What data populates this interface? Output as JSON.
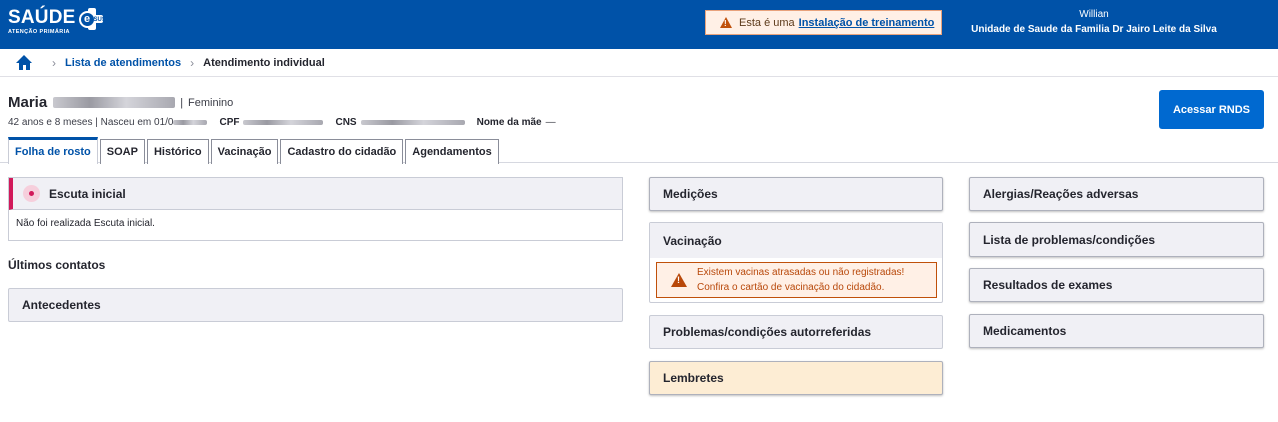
{
  "app": {
    "logo_title": "SAÚDE",
    "logo_subtitle": "ATENÇÃO PRIMÁRIA",
    "logo_badge_letter": "e",
    "logo_badge_text": "SUS",
    "brand_color": "#0052a8"
  },
  "training_banner": {
    "text": "Esta é uma",
    "link": "Instalação de treinamento",
    "icon": "warning-icon"
  },
  "user": {
    "name": "Willian",
    "unit": "Unidade de Saude da Familia Dr Jairo Leite da Silva"
  },
  "breadcrumb": {
    "home_icon": "home-icon",
    "items": [
      "Lista de atendimentos",
      "Atendimento individual"
    ]
  },
  "patient": {
    "first_name": "Maria",
    "separator": "|",
    "sex": "Feminino",
    "age_birth": "42 anos e 8 meses | Nasceu em 01/0",
    "cpf_label": "CPF",
    "cns_label": "CNS",
    "mother_label": "Nome da mãe",
    "mother_value": "—"
  },
  "actions": {
    "rnds_button": "Acessar RNDS"
  },
  "tabs": [
    {
      "label": "Folha de rosto",
      "active": true
    },
    {
      "label": "SOAP",
      "active": false
    },
    {
      "label": "Histórico",
      "active": false
    },
    {
      "label": "Vacinação",
      "active": false
    },
    {
      "label": "Cadastro do cidadão",
      "active": false
    },
    {
      "label": "Agendamentos",
      "active": false
    }
  ],
  "left_column": {
    "escuta_title": "Escuta inicial",
    "escuta_body": "Não foi realizada Escuta inicial.",
    "ultimos_contatos": "Últimos contatos",
    "antecedentes": "Antecedentes"
  },
  "middle_column": {
    "medicoes": "Medições",
    "vacinacao": "Vacinação",
    "vac_alert_line1": "Existem vacinas atrasadas ou não registradas!",
    "vac_alert_line2": "Confira o cartão de vacinação do cidadão.",
    "problemas_autorreferidas": "Problemas/condições autorreferidas",
    "lembretes": "Lembretes"
  },
  "right_column": {
    "alergias": "Alergias/Reações adversas",
    "lista_problemas": "Lista de problemas/condições",
    "resultados_exames": "Resultados de exames",
    "medicamentos": "Medicamentos"
  }
}
